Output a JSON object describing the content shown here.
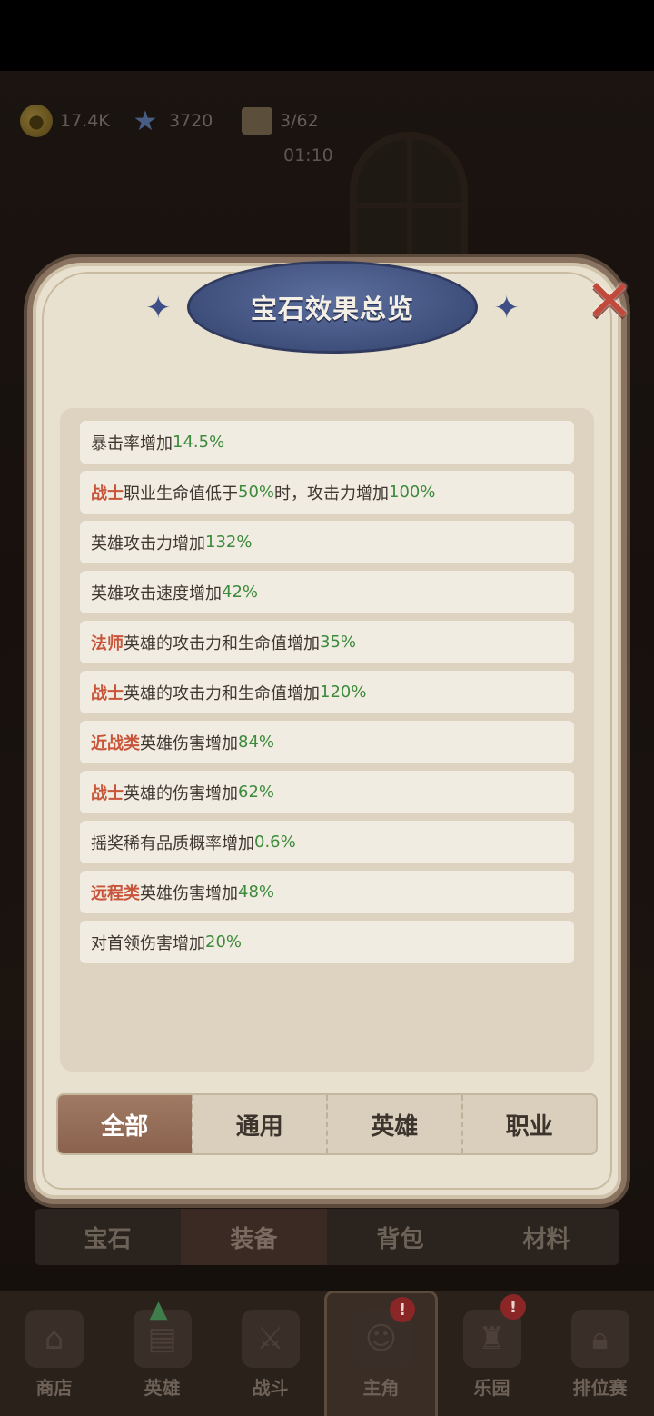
{
  "resources": {
    "gold": "17.4K",
    "gems": "3720",
    "tickets": "3/62",
    "timer": "01:10"
  },
  "modal": {
    "title": "宝石效果总览",
    "close_icon": "x-icon",
    "effects": [
      {
        "highlight": "",
        "text": "暴击率增加",
        "value": "14.5%",
        "suffix": ""
      },
      {
        "highlight": "战士",
        "text": "职业生命值低于",
        "value": "50%",
        "suffix": "时，攻击力增加",
        "value2": "100%"
      },
      {
        "highlight": "",
        "text": "英雄攻击力增加",
        "value": "132%",
        "suffix": ""
      },
      {
        "highlight": "",
        "text": "英雄攻击速度增加",
        "value": "42%",
        "suffix": ""
      },
      {
        "highlight": "法师",
        "text": "英雄的攻击力和生命值增加",
        "value": "35%",
        "suffix": ""
      },
      {
        "highlight": "战士",
        "text": "英雄的攻击力和生命值增加",
        "value": "120%",
        "suffix": ""
      },
      {
        "highlight": "近战类",
        "text": "英雄伤害增加",
        "value": "84%",
        "suffix": ""
      },
      {
        "highlight": "战士",
        "text": "英雄的伤害增加",
        "value": "62%",
        "suffix": ""
      },
      {
        "highlight": "",
        "text": "摇奖稀有品质概率增加",
        "value": "0.6%",
        "suffix": ""
      },
      {
        "highlight": "远程类",
        "text": "英雄伤害增加",
        "value": "48%",
        "suffix": ""
      },
      {
        "highlight": "",
        "text": "对首领伤害增加",
        "value": "20%",
        "suffix": ""
      }
    ],
    "tabs": [
      {
        "label": "全部",
        "active": true
      },
      {
        "label": "通用",
        "active": false
      },
      {
        "label": "英雄",
        "active": false
      },
      {
        "label": "职业",
        "active": false
      }
    ]
  },
  "subtabs": [
    {
      "label": "宝石",
      "active": false
    },
    {
      "label": "装备",
      "active": true
    },
    {
      "label": "背包",
      "active": false
    },
    {
      "label": "材料",
      "active": false
    }
  ],
  "bottom_nav": [
    {
      "label": "商店",
      "icon": "shop-icon",
      "badge": ""
    },
    {
      "label": "英雄",
      "icon": "cards-icon",
      "badge": ""
    },
    {
      "label": "战斗",
      "icon": "battle-icon",
      "badge": ""
    },
    {
      "label": "主角",
      "icon": "owl-icon",
      "badge": "!"
    },
    {
      "label": "乐园",
      "icon": "castle-icon",
      "badge": "!"
    },
    {
      "label": "排位赛",
      "icon": "lock-icon",
      "badge": ""
    }
  ],
  "colors": {
    "highlight": "#c8553a",
    "value": "#3c8a3c",
    "active_tab": "#8a624e",
    "title_banner": "#3f4f7c"
  }
}
